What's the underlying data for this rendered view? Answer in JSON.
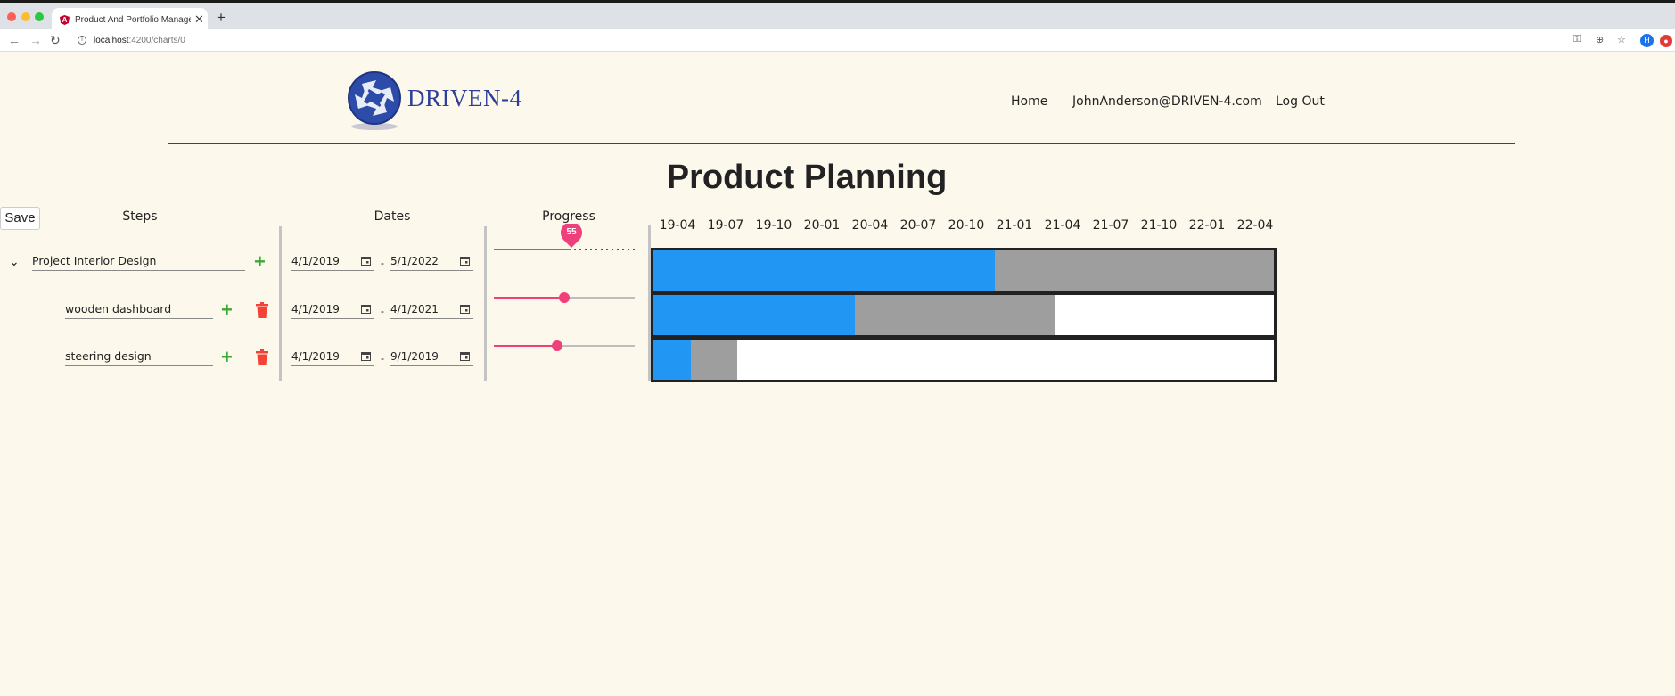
{
  "browser": {
    "tab_title": "Product And Portfolio Management",
    "tab_favicon_letter": "A",
    "url_host": "localhost",
    "url_path": ":4200/charts/0",
    "profile_initial": "H"
  },
  "header": {
    "brand": "DRIVEN-4",
    "nav": [
      "Home",
      "JohnAnderson@DRIVEN-4.com",
      "Log Out"
    ]
  },
  "page": {
    "title": "Product Planning",
    "save_label": "Save"
  },
  "columns": {
    "steps": "Steps",
    "dates": "Dates",
    "progress": "Progress"
  },
  "steps": [
    {
      "name": "Project Interior Design",
      "start": "4/1/2019",
      "end": "5/1/2022",
      "progress": 55,
      "level": 0,
      "expandable": true,
      "deletable": false
    },
    {
      "name": "wooden dashboard",
      "start": "4/1/2019",
      "end": "4/1/2021",
      "progress": 50,
      "level": 1,
      "expandable": false,
      "deletable": true
    },
    {
      "name": "steering design",
      "start": "4/1/2019",
      "end": "9/1/2019",
      "progress": 45,
      "level": 1,
      "expandable": false,
      "deletable": true
    }
  ],
  "progress_bubble": "55",
  "date_separator": "-",
  "gantt": {
    "ticks": [
      "19-04",
      "19-07",
      "19-10",
      "20-01",
      "20-04",
      "20-07",
      "20-10",
      "21-01",
      "21-04",
      "21-07",
      "21-10",
      "22-01",
      "22-04"
    ],
    "colors": {
      "done": "#2196f3",
      "remaining": "#9e9e9e",
      "empty": "#ffffff"
    }
  }
}
